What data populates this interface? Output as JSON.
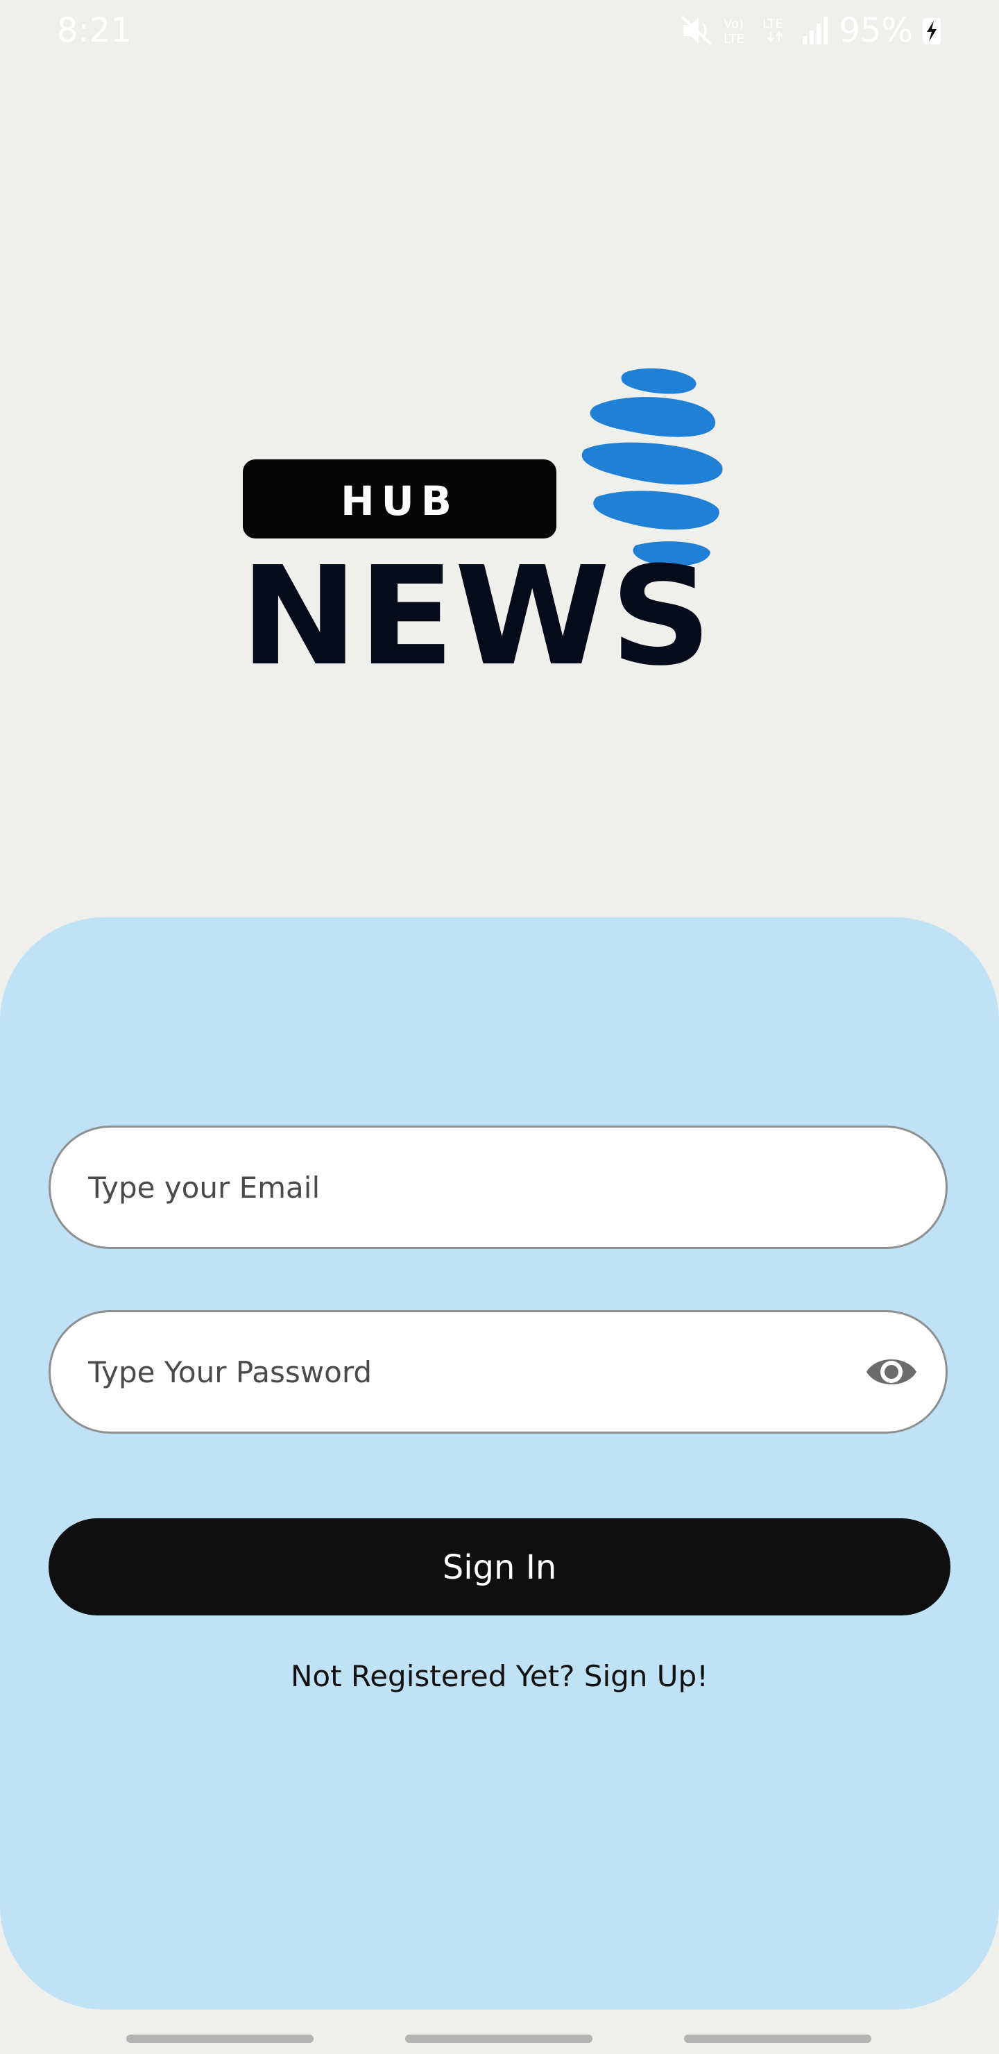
{
  "status_bar": {
    "time": "8:21",
    "battery": "95%",
    "icons": [
      "mute-icon",
      "volte-icon",
      "lte-icon",
      "signal-icon",
      "battery-charging-icon"
    ]
  },
  "logo": {
    "tag": "HUB",
    "name": "NEWS",
    "globe_color": "#1f80d6",
    "text_color": "#060b1c"
  },
  "login": {
    "email_placeholder": "Type your Email",
    "password_placeholder": "Type Your Password",
    "sign_in_label": "Sign In",
    "signup_text": "Not Registered Yet? Sign Up!",
    "panel_color": "#bfe2f7"
  }
}
